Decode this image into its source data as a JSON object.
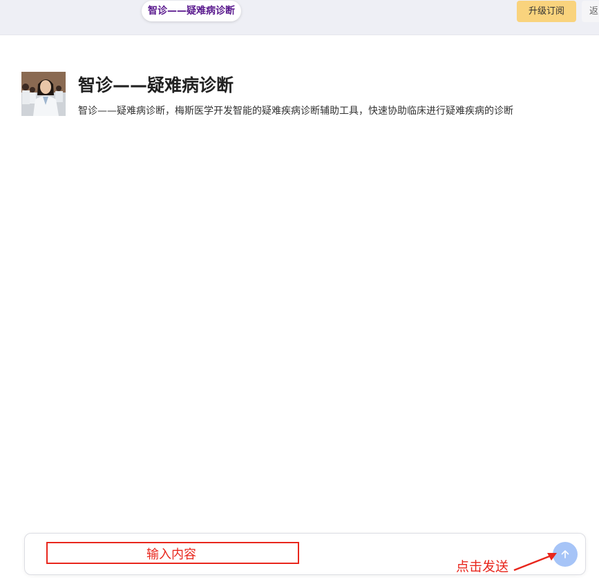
{
  "header": {
    "title": "智诊——疑难病诊断",
    "upgrade_label": "升级订阅",
    "back_label": "返"
  },
  "agent": {
    "name": "智诊——疑难病诊断",
    "description": "智诊——疑难病诊断，梅斯医学开发智能的疑难疾病诊断辅助工具，快速协助临床进行疑难疾病的诊断"
  },
  "composer": {
    "input_annotation": "输入内容",
    "send_annotation": "点击发送",
    "send_icon": "arrow-up-icon"
  },
  "colors": {
    "title_accent": "#5a1a8e",
    "upgrade_bg": "#f9d37d",
    "annotation_red": "#e8261c",
    "send_button": "#a6c4f7"
  }
}
